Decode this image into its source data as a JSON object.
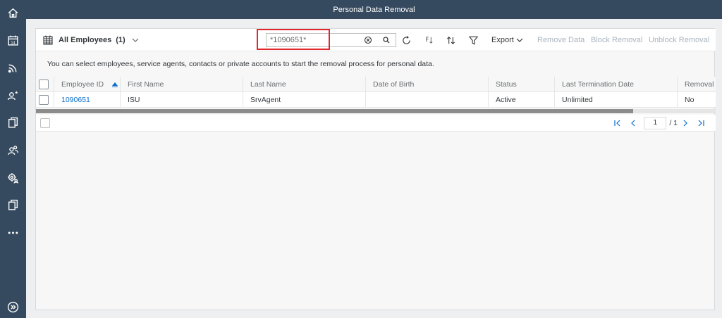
{
  "shell": {
    "title": "Personal Data Removal",
    "nav_icons": [
      "home-icon",
      "calendar-icon",
      "feed-icon",
      "employee-star-icon",
      "documents-icon",
      "groups-icon",
      "settings-users-icon",
      "copy-icon",
      "more-icon",
      "expand-icon"
    ]
  },
  "toolbar": {
    "variant_label": "All Employees",
    "variant_count": "(1)",
    "search_value": "*1090651*",
    "export_label": "Export",
    "remove_data_label": "Remove Data",
    "block_removal_label": "Block Removal",
    "unblock_removal_label": "Unblock Removal"
  },
  "info_text": "You can select employees, service agents, contacts or private accounts to start the removal process for personal data.",
  "table": {
    "columns": [
      "Employee ID",
      "First Name",
      "Last Name",
      "Date of Birth",
      "Status",
      "Last Termination Date",
      "Removal B"
    ],
    "rows": [
      {
        "employee_id": "1090651",
        "first_name": "ISU",
        "last_name": "SrvAgent",
        "date_of_birth": "",
        "status": "Active",
        "last_termination_date": "Unlimited",
        "removal_blocked": "No"
      }
    ]
  },
  "pager": {
    "current_page": "1",
    "total_pages": "/ 1"
  },
  "colors": {
    "shell": "#354a5f",
    "link": "#0a6ed1",
    "highlight": "#e3262b",
    "disabled": "#a9b4be"
  }
}
